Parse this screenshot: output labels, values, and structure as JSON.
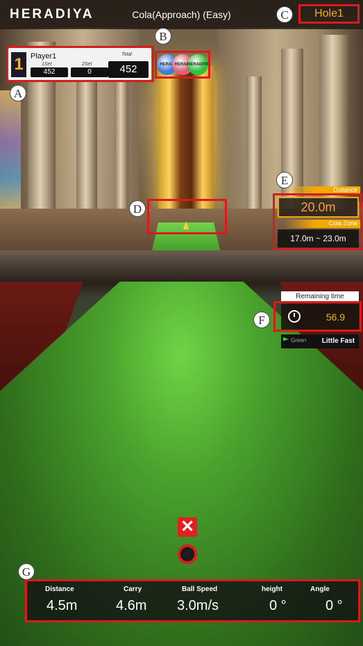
{
  "header": {
    "logo": "HERADIYA",
    "mode": "Cola(Approach) (Easy)",
    "hole": "Hole1"
  },
  "markers": {
    "a": "A",
    "b": "B",
    "c": "C",
    "d": "D",
    "e": "E",
    "f": "F",
    "g": "G"
  },
  "scorecard": {
    "hole_number": "1",
    "player": "Player1",
    "set1_label": "1Set",
    "set1_value": "452",
    "set2_label": "2Set",
    "set2_value": "0",
    "total_label": "Total",
    "total_value": "452"
  },
  "balls": [
    {
      "label": "HERAD",
      "color": "#3d7bd9"
    },
    {
      "label": "HERADI",
      "color": "#e0607a"
    },
    {
      "label": "HERADIYA",
      "color": "#2fbf3b"
    }
  ],
  "distance_panel": {
    "distance_label": "Distance",
    "distance_value": "20.0m",
    "zone_label": "Cola Zone",
    "zone_value": "17.0m ~ 23.0m"
  },
  "time_panel": {
    "label": "Remaining time",
    "value": "56.9",
    "green_label": "Green",
    "green_value": "Little Fast"
  },
  "shot": {
    "miss_icon": "x-icon",
    "ball_icon": "ball-icon"
  },
  "stats": [
    {
      "label": "Distance",
      "value": "4.5m"
    },
    {
      "label": "Carry",
      "value": "4.6m"
    },
    {
      "label": "Ball Speed",
      "value": "3.0m/s"
    },
    {
      "label": "height",
      "value": "0 °"
    },
    {
      "label": "Angle",
      "value": "0 °"
    }
  ],
  "colors": {
    "highlight": "#d81b1b",
    "accent": "#f2a900",
    "hole_text": "#f4b21a"
  }
}
